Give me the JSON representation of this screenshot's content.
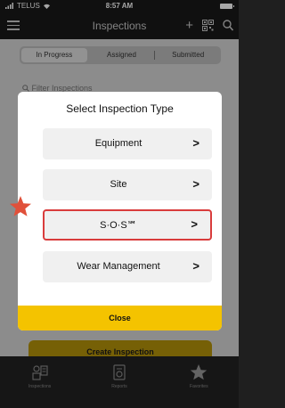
{
  "status_bar": {
    "carrier": "TELUS",
    "time": "8:57 AM"
  },
  "nav": {
    "title": "Inspections"
  },
  "segments": {
    "items": [
      "In Progress",
      "Assigned",
      "Submitted"
    ],
    "active": "In Progress"
  },
  "filter": {
    "placeholder": "Filter Inspections"
  },
  "create_button": {
    "label": "Create Inspection"
  },
  "modal": {
    "title": "Select Inspection Type",
    "options": [
      "Equipment",
      "Site",
      "S·O·S℠",
      "Wear Management"
    ],
    "highlighted_option": "S·O·S℠",
    "close_label": "Close"
  },
  "tabs": [
    {
      "label": "Inspections",
      "icon": "inspections-icon"
    },
    {
      "label": "Reports",
      "icon": "reports-icon"
    },
    {
      "label": "Favorites",
      "icon": "star-icon"
    }
  ],
  "colors": {
    "accent": "#f4c300",
    "highlight_border": "#d93c3c",
    "star": "#e0503a"
  }
}
